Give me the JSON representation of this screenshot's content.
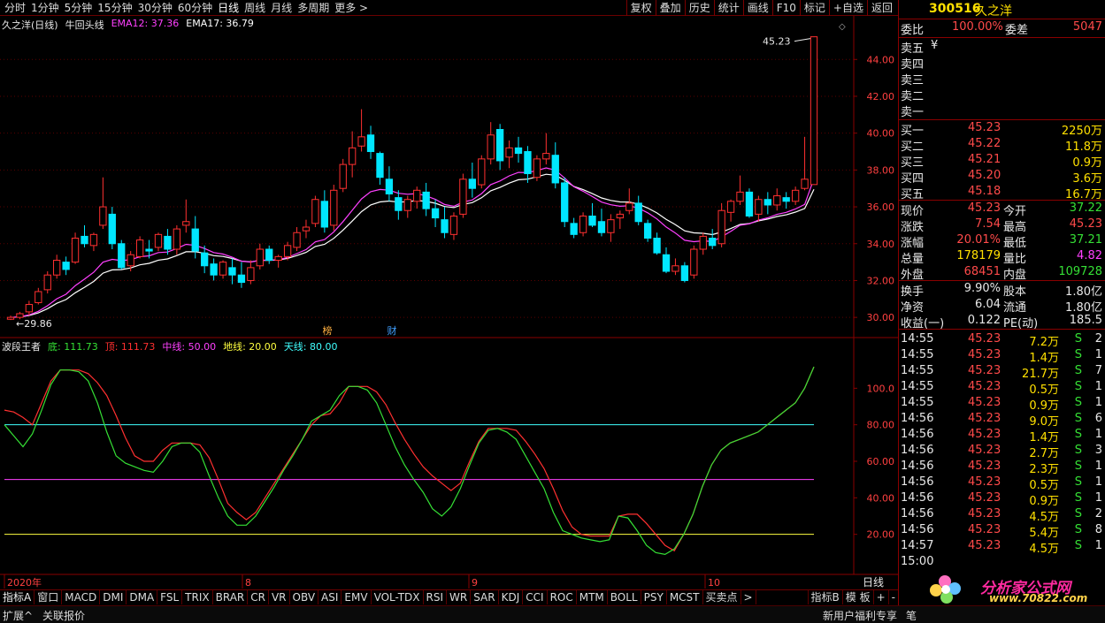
{
  "toolbar": {
    "periods": [
      "分时",
      "1分钟",
      "5分钟",
      "15分钟",
      "30分钟",
      "60分钟",
      "日线",
      "周线",
      "月线",
      "多周期",
      "更多 >"
    ],
    "active_period": "日线",
    "tools": [
      "复权",
      "叠加",
      "历史",
      "统计",
      "画线",
      "F10",
      "标记",
      "+自选",
      "返回"
    ]
  },
  "main_chart": {
    "stock_title": "久之洋(日线)",
    "indicator_name": "牛回头线",
    "ema12_label": "EMA12: 37.36",
    "ema17_label": "EMA17: 36.79",
    "high_marker": "45.23",
    "low_marker": "29.86",
    "event_tags": [
      "榜",
      "财"
    ],
    "y_ticks": [
      "44.00",
      "42.00",
      "40.00",
      "38.00",
      "36.00",
      "34.00",
      "32.00",
      "30.00"
    ],
    "colors": {
      "up": "#ff3030",
      "down": "#00e6ff",
      "ema12": "#ff40ff",
      "ema17": "#ffffff"
    }
  },
  "indicator_chart": {
    "name": "波段王者",
    "di_label": "底: 111.73",
    "ding_label": "顶: 111.73",
    "zhong_label": "中线: 50.00",
    "dixian_label": "地线: 20.00",
    "tianxian_label": "天线: 80.00",
    "y_ticks": [
      "100.0",
      "80.00",
      "60.00",
      "40.00",
      "20.00"
    ],
    "colors": {
      "di": "#35e035",
      "ding": "#ff3030",
      "zhong": "#ff40ff",
      "dixian": "#ffff40",
      "tianxian": "#40ffff"
    }
  },
  "x_axis": {
    "labels": [
      "2020年",
      "8",
      "9",
      "10"
    ],
    "period_label": "日线"
  },
  "indicator_tabs": [
    "指标A",
    "窗口",
    "MACD",
    "DMI",
    "DMA",
    "FSL",
    "TRIX",
    "BRAR",
    "CR",
    "VR",
    "OBV",
    "ASI",
    "EMV",
    "VOL-TDX",
    "RSI",
    "WR",
    "SAR",
    "KDJ",
    "CCI",
    "ROC",
    "MTM",
    "BOLL",
    "PSY",
    "MCST",
    "买卖点",
    ">"
  ],
  "indicator_tabs_right": [
    "指标B",
    "模 板",
    "+",
    "-"
  ],
  "status_bar": {
    "expand": "扩展^",
    "related": "关联报价",
    "promo": "新用户福利专享",
    "pen": "笔"
  },
  "quote": {
    "code": "300516",
    "name": "久之洋",
    "weibi_label": "委比",
    "weibi_value": "100.00%",
    "weicha_label": "委差",
    "weicha_value": "5047",
    "asks": [
      {
        "label": "卖五",
        "price": "",
        "vol": ""
      },
      {
        "label": "卖四",
        "price": "",
        "vol": ""
      },
      {
        "label": "卖三",
        "price": "",
        "vol": ""
      },
      {
        "label": "卖二",
        "price": "",
        "vol": ""
      },
      {
        "label": "卖一",
        "price": "",
        "vol": ""
      }
    ],
    "ask_currency": "¥",
    "bids": [
      {
        "label": "买一",
        "price": "45.23",
        "vol": "2250万"
      },
      {
        "label": "买二",
        "price": "45.22",
        "vol": "11.8万"
      },
      {
        "label": "买三",
        "price": "45.21",
        "vol": "0.9万"
      },
      {
        "label": "买四",
        "price": "45.20",
        "vol": "3.6万"
      },
      {
        "label": "买五",
        "price": "45.18",
        "vol": "16.7万"
      }
    ],
    "stats": [
      [
        {
          "l": "现价",
          "v": "45.23",
          "c": "red"
        },
        {
          "l": "今开",
          "v": "37.22",
          "c": "green"
        }
      ],
      [
        {
          "l": "涨跌",
          "v": "7.54",
          "c": "red"
        },
        {
          "l": "最高",
          "v": "45.23",
          "c": "red"
        }
      ],
      [
        {
          "l": "涨幅",
          "v": "20.01%",
          "c": "red"
        },
        {
          "l": "最低",
          "v": "37.21",
          "c": "green"
        }
      ],
      [
        {
          "l": "总量",
          "v": "178179",
          "c": "yellow"
        },
        {
          "l": "量比",
          "v": "4.82",
          "c": "mag"
        }
      ],
      [
        {
          "l": "外盘",
          "v": "68451",
          "c": "red"
        },
        {
          "l": "内盘",
          "v": "109728",
          "c": "green"
        }
      ]
    ],
    "stats2": [
      [
        {
          "l": "换手",
          "v": "9.90%",
          "c": "white"
        },
        {
          "l": "股本",
          "v": "1.80亿",
          "c": "white"
        }
      ],
      [
        {
          "l": "净资",
          "v": "6.04",
          "c": "white"
        },
        {
          "l": "流通",
          "v": "1.80亿",
          "c": "white"
        }
      ],
      [
        {
          "l": "收益(一)",
          "v": "0.122",
          "c": "white"
        },
        {
          "l": "PE(动)",
          "v": "185.5",
          "c": "white"
        }
      ]
    ],
    "ticks": [
      {
        "t": "14:55",
        "p": "45.23",
        "v": "7.2万",
        "s": "S",
        "n": "2"
      },
      {
        "t": "14:55",
        "p": "45.23",
        "v": "1.4万",
        "s": "S",
        "n": "1"
      },
      {
        "t": "14:55",
        "p": "45.23",
        "v": "21.7万",
        "s": "S",
        "n": "7"
      },
      {
        "t": "14:55",
        "p": "45.23",
        "v": "0.5万",
        "s": "S",
        "n": "1"
      },
      {
        "t": "14:55",
        "p": "45.23",
        "v": "0.9万",
        "s": "S",
        "n": "1"
      },
      {
        "t": "14:56",
        "p": "45.23",
        "v": "9.0万",
        "s": "S",
        "n": "6"
      },
      {
        "t": "14:56",
        "p": "45.23",
        "v": "1.4万",
        "s": "S",
        "n": "1"
      },
      {
        "t": "14:56",
        "p": "45.23",
        "v": "2.7万",
        "s": "S",
        "n": "3"
      },
      {
        "t": "14:56",
        "p": "45.23",
        "v": "2.3万",
        "s": "S",
        "n": "1"
      },
      {
        "t": "14:56",
        "p": "45.23",
        "v": "0.5万",
        "s": "S",
        "n": "1"
      },
      {
        "t": "14:56",
        "p": "45.23",
        "v": "0.9万",
        "s": "S",
        "n": "1"
      },
      {
        "t": "14:56",
        "p": "45.23",
        "v": "4.5万",
        "s": "S",
        "n": "2"
      },
      {
        "t": "14:56",
        "p": "45.23",
        "v": "5.4万",
        "s": "S",
        "n": "8"
      },
      {
        "t": "14:57",
        "p": "45.23",
        "v": "4.5万",
        "s": "S",
        "n": "1"
      },
      {
        "t": "15:00",
        "p": "",
        "v": "",
        "s": "",
        "n": ""
      }
    ]
  },
  "watermark": {
    "text": "分析家公式网",
    "url": "www.70822.com"
  },
  "chart_data": [
    {
      "type": "candlestick",
      "title": "久之洋(日线)",
      "ylim": [
        29,
        45.5
      ],
      "candles": [
        [
          29.9,
          30.1,
          29.86,
          30.0
        ],
        [
          30.0,
          30.3,
          29.9,
          30.2
        ],
        [
          30.3,
          30.9,
          30.1,
          30.7
        ],
        [
          30.8,
          31.6,
          30.7,
          31.4
        ],
        [
          31.5,
          32.5,
          31.3,
          32.3
        ],
        [
          32.3,
          33.4,
          32.1,
          33.1
        ],
        [
          33.0,
          33.3,
          32.3,
          32.6
        ],
        [
          33.0,
          34.6,
          32.9,
          34.3
        ],
        [
          34.4,
          35.0,
          33.8,
          34.0
        ],
        [
          33.9,
          34.6,
          33.6,
          34.5
        ],
        [
          35.0,
          37.6,
          34.8,
          36.0
        ],
        [
          35.6,
          36.0,
          33.7,
          34.0
        ],
        [
          34.0,
          34.2,
          32.6,
          32.7
        ],
        [
          32.8,
          33.6,
          32.5,
          33.4
        ],
        [
          33.3,
          34.4,
          33.2,
          34.2
        ],
        [
          33.7,
          34.2,
          33.2,
          33.6
        ],
        [
          33.8,
          34.6,
          33.6,
          34.5
        ],
        [
          34.4,
          34.8,
          33.4,
          33.7
        ],
        [
          33.7,
          35.0,
          33.4,
          34.8
        ],
        [
          35.0,
          36.4,
          34.6,
          35.2
        ],
        [
          34.8,
          35.5,
          33.2,
          33.6
        ],
        [
          33.5,
          33.9,
          32.4,
          32.8
        ],
        [
          32.9,
          33.2,
          32.0,
          32.3
        ],
        [
          32.3,
          33.1,
          32.1,
          33.0
        ],
        [
          32.7,
          33.2,
          31.8,
          32.3
        ],
        [
          32.3,
          33.0,
          31.6,
          31.9
        ],
        [
          32.0,
          33.1,
          31.8,
          32.7
        ],
        [
          32.8,
          34.0,
          32.6,
          33.7
        ],
        [
          33.7,
          33.9,
          32.9,
          33.1
        ],
        [
          33.1,
          33.4,
          32.7,
          33.3
        ],
        [
          33.3,
          34.1,
          33.1,
          33.9
        ],
        [
          33.8,
          34.9,
          33.6,
          34.6
        ],
        [
          34.7,
          35.3,
          34.3,
          34.9
        ],
        [
          35.1,
          36.6,
          34.9,
          36.4
        ],
        [
          36.3,
          36.9,
          34.6,
          34.9
        ],
        [
          35.0,
          37.2,
          34.7,
          36.9
        ],
        [
          37.0,
          38.6,
          36.8,
          38.3
        ],
        [
          38.3,
          40.1,
          37.6,
          39.2
        ],
        [
          39.3,
          41.3,
          39.0,
          39.8
        ],
        [
          39.9,
          40.4,
          38.6,
          39.0
        ],
        [
          38.9,
          39.0,
          37.2,
          37.6
        ],
        [
          37.5,
          38.2,
          36.3,
          36.7
        ],
        [
          36.5,
          36.9,
          35.3,
          35.8
        ],
        [
          35.8,
          36.6,
          35.4,
          36.4
        ],
        [
          36.3,
          37.1,
          35.9,
          36.9
        ],
        [
          36.8,
          37.3,
          35.5,
          35.9
        ],
        [
          35.9,
          36.4,
          34.9,
          35.4
        ],
        [
          35.3,
          36.0,
          34.3,
          34.6
        ],
        [
          34.5,
          35.7,
          34.2,
          35.5
        ],
        [
          35.6,
          37.8,
          35.4,
          37.5
        ],
        [
          37.5,
          38.4,
          36.5,
          37.0
        ],
        [
          37.2,
          38.8,
          37.0,
          38.6
        ],
        [
          38.6,
          40.6,
          38.3,
          39.9
        ],
        [
          40.2,
          40.5,
          38.0,
          38.5
        ],
        [
          38.7,
          39.6,
          38.1,
          39.2
        ],
        [
          39.2,
          39.8,
          38.4,
          38.9
        ],
        [
          39.0,
          39.3,
          37.3,
          37.8
        ],
        [
          37.6,
          38.8,
          37.4,
          38.6
        ],
        [
          38.6,
          40.0,
          38.3,
          38.9
        ],
        [
          38.8,
          39.5,
          37.0,
          37.3
        ],
        [
          37.3,
          37.6,
          34.9,
          35.2
        ],
        [
          35.1,
          35.4,
          34.3,
          34.5
        ],
        [
          34.6,
          35.7,
          34.4,
          35.5
        ],
        [
          35.5,
          36.2,
          34.9,
          35.0
        ],
        [
          35.2,
          35.9,
          34.4,
          34.6
        ],
        [
          34.6,
          35.6,
          34.1,
          35.3
        ],
        [
          35.4,
          35.8,
          34.8,
          35.6
        ],
        [
          35.8,
          37.0,
          35.6,
          36.2
        ],
        [
          36.2,
          36.6,
          35.0,
          35.2
        ],
        [
          35.1,
          35.3,
          34.1,
          34.3
        ],
        [
          34.3,
          34.6,
          33.4,
          33.5
        ],
        [
          33.4,
          33.8,
          32.4,
          32.5
        ],
        [
          32.5,
          33.2,
          32.3,
          32.8
        ],
        [
          32.8,
          33.0,
          31.9,
          32.0
        ],
        [
          32.3,
          33.9,
          32.1,
          33.7
        ],
        [
          33.7,
          34.6,
          33.4,
          34.4
        ],
        [
          34.3,
          34.8,
          33.7,
          33.9
        ],
        [
          34.0,
          36.2,
          33.8,
          35.8
        ],
        [
          35.7,
          36.4,
          35.2,
          36.3
        ],
        [
          36.3,
          37.7,
          36.1,
          36.8
        ],
        [
          36.8,
          37.0,
          35.4,
          35.5
        ],
        [
          35.6,
          36.6,
          35.2,
          36.4
        ],
        [
          36.4,
          36.8,
          35.6,
          36.1
        ],
        [
          36.1,
          37.0,
          35.8,
          36.6
        ],
        [
          36.5,
          36.8,
          35.9,
          36.3
        ],
        [
          36.3,
          37.1,
          36.1,
          36.9
        ],
        [
          37.0,
          39.8,
          36.9,
          37.5
        ],
        [
          37.21,
          45.23,
          37.21,
          45.23
        ]
      ]
    },
    {
      "type": "line",
      "title": "波段王者",
      "ylim": [
        0,
        120
      ],
      "series": [
        {
          "name": "底",
          "values": [
            80,
            74,
            68,
            75,
            88,
            102,
            110,
            110,
            109,
            104,
            92,
            76,
            63,
            59,
            57,
            55,
            54,
            60,
            68,
            70,
            70,
            65,
            52,
            40,
            30,
            25,
            25,
            30,
            38,
            46,
            55,
            63,
            72,
            82,
            85,
            88,
            96,
            101,
            101,
            99,
            92,
            80,
            68,
            58,
            50,
            43,
            34,
            30,
            35,
            45,
            58,
            70,
            77,
            78,
            76,
            72,
            63,
            54,
            45,
            32,
            22,
            20,
            18,
            17,
            16,
            17,
            30,
            29,
            22,
            14,
            10,
            9,
            12,
            20,
            31,
            46,
            58,
            66,
            70,
            72,
            74,
            76,
            80,
            84,
            88,
            92,
            100,
            111.73
          ]
        },
        {
          "name": "顶",
          "values": [
            88,
            87,
            84,
            80,
            92,
            104,
            110,
            110,
            110,
            108,
            103,
            96,
            85,
            73,
            63,
            60,
            60,
            66,
            70,
            70,
            70,
            69,
            62,
            50,
            37,
            32,
            28,
            32,
            40,
            48,
            56,
            64,
            72,
            80,
            85,
            86,
            92,
            101,
            101,
            101,
            98,
            91,
            81,
            72,
            64,
            57,
            52,
            48,
            44,
            48,
            60,
            71,
            78,
            78,
            78,
            77,
            71,
            64,
            56,
            45,
            33,
            24,
            20,
            19,
            19,
            19,
            30,
            31,
            31,
            26,
            20,
            14,
            11,
            20,
            31,
            46,
            58,
            66,
            70,
            72,
            74,
            76,
            80,
            84,
            88,
            92,
            100,
            111.73
          ]
        },
        {
          "name": "中线",
          "values": [
            50
          ]
        },
        {
          "name": "地线",
          "values": [
            20
          ]
        },
        {
          "name": "天线",
          "values": [
            80
          ]
        }
      ]
    }
  ]
}
